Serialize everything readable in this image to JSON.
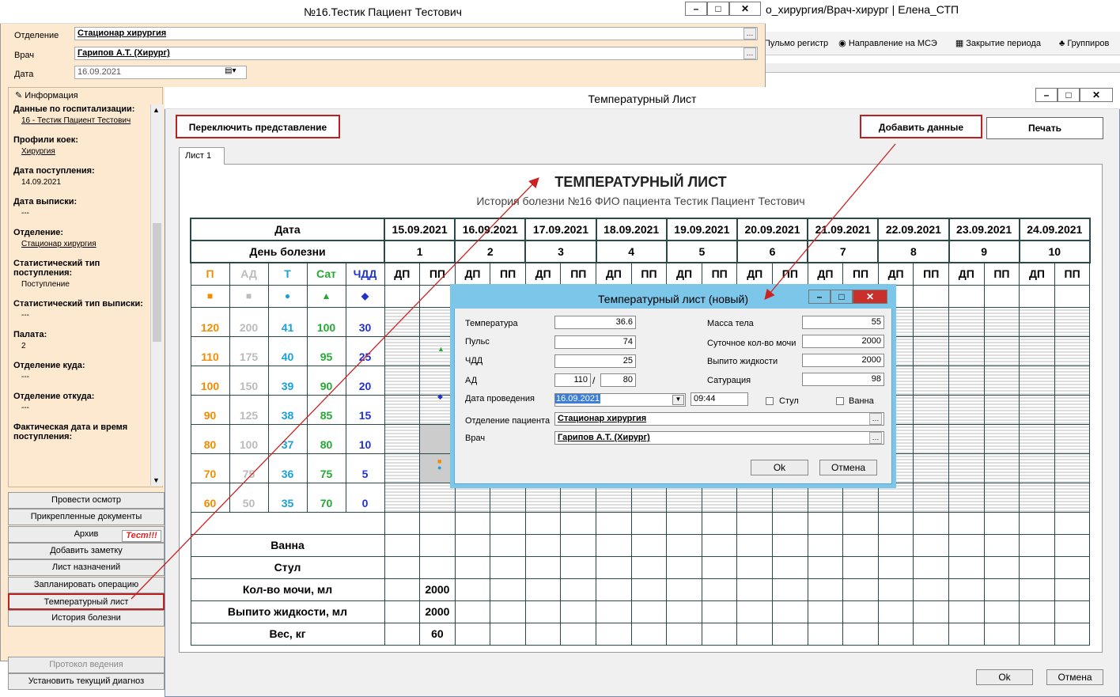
{
  "bg": {
    "title": "о_хирургия/Врач-хирург | Елена_СТП",
    "tools": [
      "Пульмо регистр",
      "Направление на МСЭ",
      "Закрытие периода",
      "Группиров"
    ]
  },
  "patient": {
    "title": "№16.Тестик Пациент Тестович",
    "department_label": "Отделение",
    "department": "Стационар хирургия",
    "doctor_label": "Врач",
    "doctor": "Гарипов А.Т. (Хирург)",
    "date_label": "Дата",
    "date": "16.09.2021"
  },
  "sidebar": {
    "header": "Информация",
    "items": [
      {
        "h": "Данные по госпитализации:",
        "v": "16 - Тестик Пациент Тестович",
        "link": true
      },
      {
        "h": "Профили коек:",
        "v": "Хирургия",
        "link": true
      },
      {
        "h": "Дата поступления:",
        "v": "14.09.2021",
        "link": false
      },
      {
        "h": "Дата выписки:",
        "v": "---",
        "link": false
      },
      {
        "h": "Отделение:",
        "v": "Стационар хирургия",
        "link": true
      },
      {
        "h": "Статистический тип поступления:",
        "v": "Поступление",
        "link": false
      },
      {
        "h": "Статистический тип выписки:",
        "v": "---",
        "link": false
      },
      {
        "h": "Палата:",
        "v": "2",
        "link": false
      },
      {
        "h": "Отделение куда:",
        "v": "---",
        "link": false
      },
      {
        "h": "Отделение откуда:",
        "v": "---",
        "link": false
      },
      {
        "h": "Фактическая дата и время поступления:",
        "v": "",
        "link": false
      }
    ],
    "buttons": [
      "Провести осмотр",
      "Прикрепленные документы",
      "Архив",
      "Добавить заметку",
      "Лист назначений",
      "Запланировать операцию",
      "Температурный лист",
      "История болезни",
      "Протокол ведения",
      "Установить текущий диагноз"
    ],
    "test_badge": "Тест!!!"
  },
  "temp": {
    "title": "Температурный Лист",
    "switch": "Переключить представление",
    "add": "Добавить данные",
    "print": "Печать",
    "tab": "Лист 1",
    "heading": "ТЕМПЕРАТУРНЫЙ ЛИСТ",
    "subheading": "История болезни №16 ФИО пациента Тестик Пациент Тестович",
    "date_label": "Дата",
    "day_label": "День болезни",
    "dates": [
      "15.09.2021",
      "16.09.2021",
      "17.09.2021",
      "18.09.2021",
      "19.09.2021",
      "20.09.2021",
      "21.09.2021",
      "22.09.2021",
      "23.09.2021",
      "24.09.2021"
    ],
    "days": [
      "1",
      "2",
      "3",
      "4",
      "5",
      "6",
      "7",
      "8",
      "9",
      "10"
    ],
    "dp": "ДП",
    "pp": "ПП",
    "params": [
      "П",
      "АД",
      "Т",
      "Сат",
      "ЧДД"
    ],
    "param_colors": [
      "#f28c00",
      "#bbbbbb",
      "#1aa0d8",
      "#22aa33",
      "#2233cc"
    ],
    "scale": [
      [
        "120",
        "200",
        "41",
        "100",
        "30"
      ],
      [
        "110",
        "175",
        "40",
        "95",
        "25"
      ],
      [
        "100",
        "150",
        "39",
        "90",
        "20"
      ],
      [
        "90",
        "125",
        "38",
        "85",
        "15"
      ],
      [
        "80",
        "100",
        "37",
        "80",
        "10"
      ],
      [
        "70",
        "75",
        "36",
        "75",
        "5"
      ],
      [
        "60",
        "50",
        "35",
        "70",
        "0"
      ]
    ],
    "bottom": [
      {
        "label": "Ванна",
        "v": ""
      },
      {
        "label": "Стул",
        "v": ""
      },
      {
        "label": "Кол-во мочи, мл",
        "v": "2000"
      },
      {
        "label": "Выпито жидкости, мл",
        "v": "2000"
      },
      {
        "label": "Вес, кг",
        "v": "60"
      }
    ],
    "ok": "Ok",
    "cancel": "Отмена"
  },
  "dialog": {
    "title": "Температурный лист (новый)",
    "temp_label": "Температура",
    "temp": "36.6",
    "pulse_label": "Пульс",
    "pulse": "74",
    "chdd_label": "ЧДД",
    "chdd": "25",
    "ad_label": "АД",
    "ad1": "110",
    "ad2": "80",
    "date_label": "Дата проведения",
    "date": "16.09.2021",
    "time": "09:44",
    "stool": "Стул",
    "bath": "Ванна",
    "weight_label": "Масса тела",
    "weight": "55",
    "urine_label": "Суточное кол-во мочи",
    "urine": "2000",
    "drink_label": "Выпито жидкости",
    "drink": "2000",
    "sat_label": "Сатурация",
    "sat": "98",
    "dep_label": "Отделение пациента",
    "dep": "Стационар хирургия",
    "doc_label": "Врач",
    "doc": "Гарипов А.Т. (Хирург)",
    "ok": "Ok",
    "cancel": "Отмена"
  }
}
